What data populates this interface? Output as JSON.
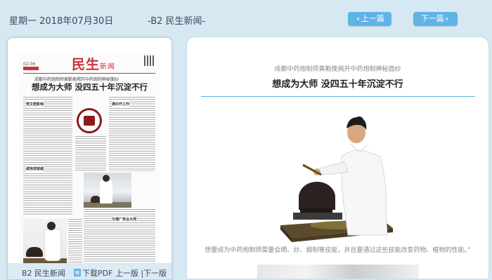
{
  "header": {
    "date": "星期一  2018年07月30日",
    "section": "-B2 民生新闻-",
    "prev_label": "上一篇",
    "next_label": "下一篇",
    "prev_icon": "chevron-left-icon",
    "next_icon": "chevron-right-icon"
  },
  "thumbnail": {
    "masthead_title": "民生",
    "masthead_suffix": "新闻",
    "masthead_date": "02-06",
    "kicker": "成都中药炮制师黄勤挽揭开中药炮制神秘面纱",
    "headline": "想成为大师 没四五十年沉淀不行",
    "sub_items": [
      "党文若影响",
      "溯中开工作",
      "咸用成就越",
      "为增厂务业大师"
    ],
    "footer": {
      "section": "B2 民生新闻",
      "download_pdf": "下载PDF",
      "prev_page": "上一版",
      "separator": "|",
      "next_page": "下一版"
    }
  },
  "article": {
    "kicker": "成都中药炮制师黄勤挽揭开中药炮制神秘面纱",
    "title": "想成为大师 没四五十年沉淀不行",
    "caption": "想要成为中药炮制师需要会晒、炒、煅制等技能，并且要通过这些技能改变药物、植物的性能。”"
  },
  "colors": {
    "background": "#d6e9f3",
    "accent": "#5fb4e6",
    "masthead_red": "#c8343c"
  }
}
